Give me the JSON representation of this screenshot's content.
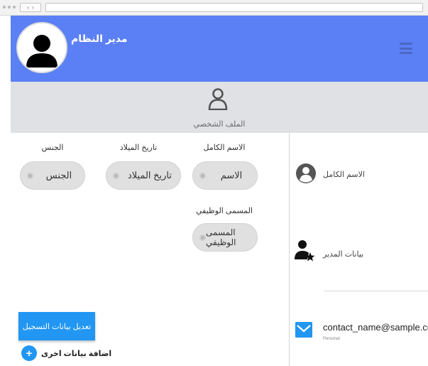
{
  "header": {
    "admin_name": "مدير النظام"
  },
  "profile": {
    "title": "الملف الشخصي"
  },
  "form": {
    "full_name": {
      "label": "الاسم الكامل",
      "value": "الاسم"
    },
    "birth_date": {
      "label": "تاريخ الميلاد",
      "value": "تاريخ الميلاد"
    },
    "gender": {
      "label": "الجنس",
      "value": "الجنس"
    },
    "job_title": {
      "label": "المسمى الوظيفي",
      "value": "المسمى الوظيفي"
    }
  },
  "actions": {
    "edit_registration": "تعديل بيانات التسجيل",
    "add_more": "اضافة بيانات اخرى",
    "add_symbol": "+"
  },
  "side": {
    "full_name_label": "الاسم الكامل",
    "admin_data_label": "بيانات المدير",
    "email": "contact_name@sample.com",
    "email_type": "Personal"
  },
  "colors": {
    "header": "#5b80f5",
    "profile_bar": "#dfe1e4",
    "accent": "#2196f3",
    "icon_dark": "#555555"
  },
  "icons": [
    "menu-icon",
    "avatar-icon",
    "user-outline-icon",
    "account-circle-icon",
    "user-star-icon",
    "mail-icon",
    "add-icon"
  ]
}
